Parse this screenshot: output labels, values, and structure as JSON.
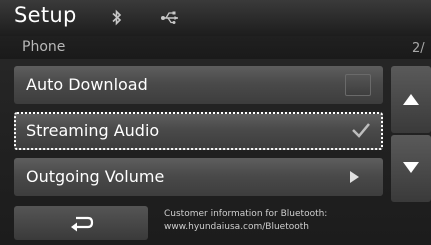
{
  "header": {
    "title": "Setup",
    "icons": [
      "bluetooth-icon",
      "usb-icon"
    ]
  },
  "subheader": {
    "title": "Phone",
    "page_indicator": "2/"
  },
  "menu": {
    "items": [
      {
        "label": "Auto Download",
        "control": "checkbox",
        "checked": false
      },
      {
        "label": "Streaming Audio",
        "control": "checkbox",
        "checked": true,
        "focused": true
      },
      {
        "label": "Outgoing Volume",
        "control": "submenu-arrow"
      }
    ]
  },
  "footer": {
    "back_icon": "back-arrow-icon",
    "info_line1": "Customer information for Bluetooth:",
    "info_line2": "www.hyundaiusa.com/Bluetooth"
  },
  "colors": {
    "background": "#222222",
    "item": "#4a4a4a",
    "text": "#ffffff",
    "focus_outline": "#ffffff"
  }
}
